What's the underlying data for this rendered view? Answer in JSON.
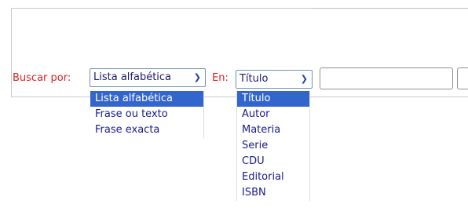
{
  "search": {
    "buscar_label": "Buscar por:",
    "buscar_value": "Lista alfabética",
    "en_label": "En:",
    "en_value": "Título",
    "query_value": ""
  },
  "buscar_options": [
    "Lista alfabética",
    "Frase ou texto",
    "Frase exacta"
  ],
  "en_options": [
    "Título",
    "Autor",
    "Materia",
    "Serie",
    "CDU",
    "Editorial",
    "ISBN"
  ],
  "colors": {
    "label_red": "#e0211d",
    "highlight_blue": "#3366cc",
    "option_text": "#1a1a8e"
  }
}
